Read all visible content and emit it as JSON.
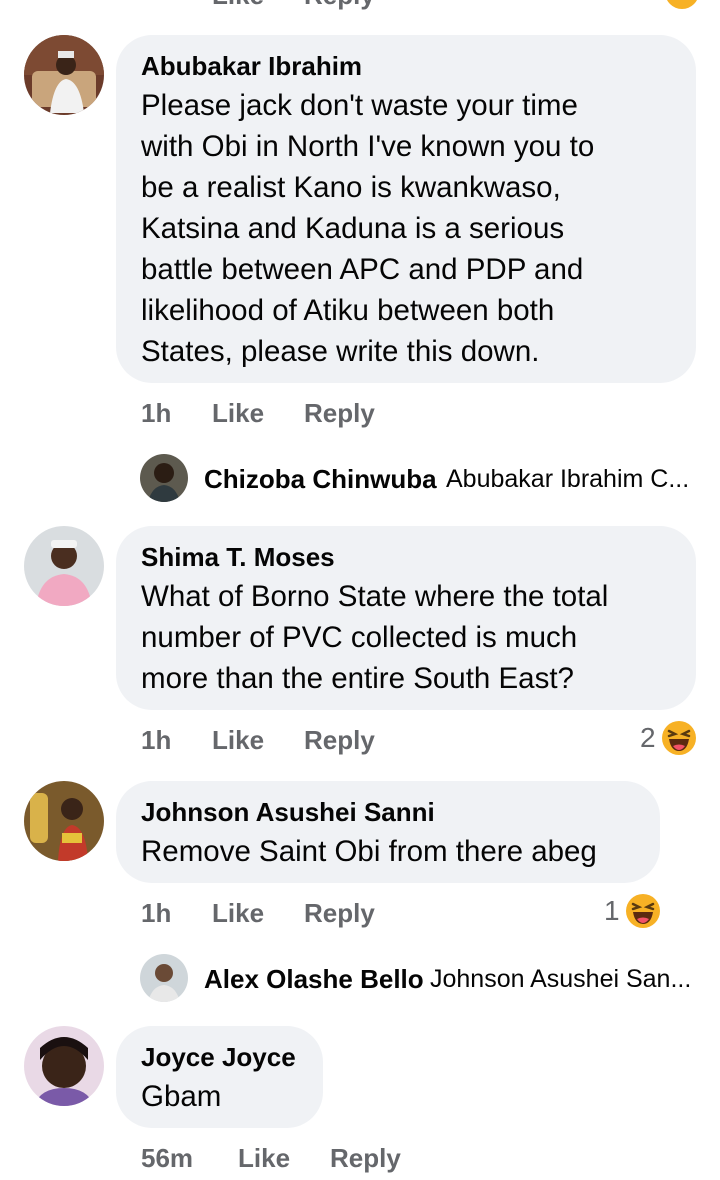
{
  "comments": [
    {
      "author": "Abubakar Ibrahim",
      "lines": [
        "Please jack don't waste your time",
        "with Obi in North I've known you to",
        "be a realist Kano is kwankwaso,",
        "Katsina and Kaduna is a serious",
        "battle between APC and PDP and",
        "likelihood of Atiku between both",
        "States, please write this down."
      ],
      "time": "1h",
      "like": "Like",
      "reply": "Reply",
      "reply_preview": {
        "name": "Chizoba Chinwuba",
        "snippet": "Abubakar Ibrahim C..."
      }
    },
    {
      "author": "Shima T. Moses",
      "lines": [
        "What of Borno State where the total",
        "number of PVC collected is much",
        "more than the entire South East?"
      ],
      "time": "1h",
      "like": "Like",
      "reply": "Reply",
      "reaction": {
        "count": "2",
        "icon": "haha-emoji"
      }
    },
    {
      "author": "Johnson Asushei Sanni",
      "lines": [
        "Remove Saint Obi from there abeg"
      ],
      "time": "1h",
      "like": "Like",
      "reply": "Reply",
      "reaction": {
        "count": "1",
        "icon": "haha-emoji"
      },
      "reply_preview": {
        "name": "Alex Olashe Bello",
        "snippet": "Johnson Asushei San..."
      }
    },
    {
      "author": "Joyce Joyce",
      "lines": [
        "Gbam"
      ],
      "time": "56m",
      "like": "Like",
      "reply": "Reply"
    }
  ],
  "top_partial": {
    "like": "Like",
    "reply": "Reply"
  },
  "colors": {
    "bubble": "#f0f2f5",
    "meta": "#65676b",
    "text": "#050505",
    "emoji": "#f7b125"
  }
}
